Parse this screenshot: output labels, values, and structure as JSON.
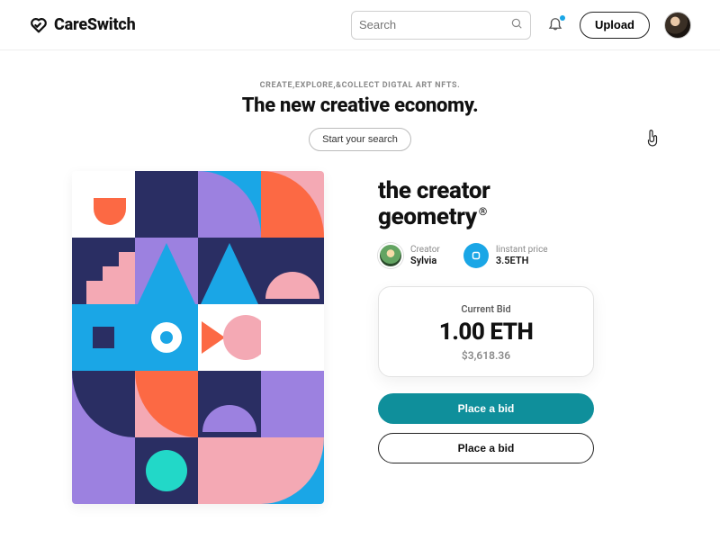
{
  "brand": {
    "name": "CareSwitch"
  },
  "header": {
    "search_placeholder": "Search",
    "upload_label": "Upload"
  },
  "hero": {
    "overline": "CREATE,EXPLORE,&COLLECT DIGTAL ART NFTS.",
    "title": "The new creative economy.",
    "cta_label": "Start your search"
  },
  "nft": {
    "title_line1": "the creator",
    "title_line2": "geometry",
    "registered_mark": "®"
  },
  "creator": {
    "label": "Creator",
    "name": "Sylvia"
  },
  "instant": {
    "label": "Iinstant price",
    "value": "3.5ETH"
  },
  "bid": {
    "label": "Current Bid",
    "amount": "1.00 ETH",
    "usd": "$3,618.36"
  },
  "cta": {
    "primary": "Place a bid",
    "secondary": "Place a bid"
  },
  "colors": {
    "navy": "#2a2e63",
    "blue": "#1aa6e6",
    "orange": "#fc6944",
    "lavender": "#9c81e0",
    "pink": "#f4a9b4",
    "teal": "#0f8f9b"
  }
}
